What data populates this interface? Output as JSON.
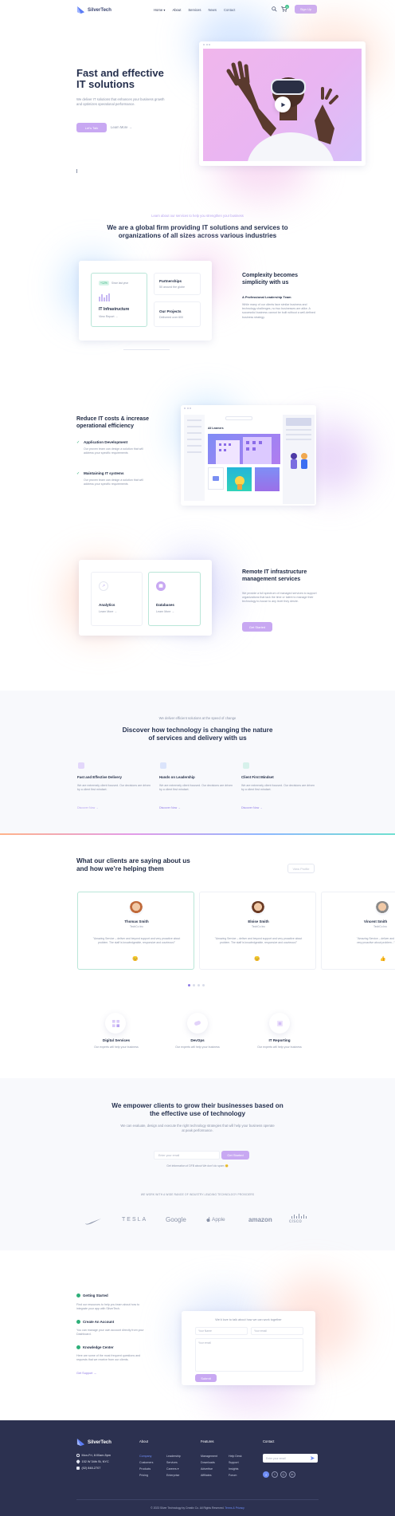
{
  "header": {
    "brand": "SilverTech",
    "nav": [
      "Home ▾",
      "About",
      "Services",
      "News",
      "Contact"
    ],
    "cta": "Sign Up",
    "cart_badge": "0"
  },
  "hero": {
    "title_line1": "Fast and effective",
    "title_line2": "IT solutions",
    "text": "We deliver IT solutions that enhances your business growth and optimizes operational performance.",
    "primary_btn": "Let's Talk",
    "secondary_link": "Learn More →"
  },
  "intro": {
    "eyebrow": "Learn about our services to help you strengthen your business",
    "title_line1": "We are a global firm providing IT solutions and services to",
    "title_line2": "organizations of all sizes across various industries"
  },
  "feature1": {
    "badge": "+12%",
    "badge_note": "Since last year",
    "card1_title": "IT Infrastructure",
    "card1_link": "View Report →",
    "card2_title": "Partnerships",
    "card2_text": "50 around the globe",
    "card3_title": "Our Projects",
    "card3_text": "Delivered over 600",
    "heading_line1": "Complexity becomes",
    "heading_line2": "simplicity with us",
    "subheading": "A Professional Leadership Team",
    "text": "While many of our clients face similar business and technology challenges, no two businesses are alike. A successful business cannot be built without a well-defined business strategy."
  },
  "feature2": {
    "heading_line1": "Reduce IT costs & increase",
    "heading_line2": "operational efficiency",
    "items": [
      {
        "title": "Application Development",
        "text": "Our proven team can design a solution that will address your specific requirements"
      },
      {
        "title": "Maintaining IT systems",
        "text": "Our proven team can design a solution that will address your specific requirements"
      }
    ],
    "app_label": "All Learners",
    "app_tile": "Create Folder"
  },
  "feature3": {
    "card1_title": "Analytics",
    "card1_link": "Learn More →",
    "card2_title": "Databases",
    "card2_link": "Learn More →",
    "heading_line1": "Remote IT infrastructure",
    "heading_line2": "management services",
    "text": "We provide a full spectrum of managed services to support organizations that lack the time or talent to manage their technology in-house to any level they desire.",
    "btn": "Get Started"
  },
  "discover": {
    "eyebrow": "We deliver efficient solutions at the speed of change",
    "title_line1": "Discover how technology is changing the nature",
    "title_line2": "of services and delivery with us",
    "items": [
      {
        "title": "Fast and Effective Delivery",
        "text": "We are extremely client focused. Our decisions are driven by a client first mindset.",
        "link": "Discover Now →"
      },
      {
        "title": "Hands on Leadership",
        "text": "We are extremely client focused. Our decisions are driven by a client first mindset.",
        "link": "Discover Now →"
      },
      {
        "title": "Client First Mindset",
        "text": "We are extremely client focused. Our decisions are driven by a client first mindset.",
        "link": "Discover Now →"
      }
    ]
  },
  "testimonials": {
    "title_line1": "What our clients are saying about us",
    "title_line2": "and how we’re helping them",
    "btn": "View Profile",
    "items": [
      {
        "name": "Thomas Smith",
        "company": "TechCo Inc",
        "quote": "\"Amazing Service – deliver and beyond support and very proactive about problem. The staff is knowledgeable, responsive and courteous!\""
      },
      {
        "name": "Eloise Smith",
        "company": "TechCo Inc",
        "quote": "\"Amazing Service – deliver and beyond support and very proactive about problem. The staff is knowledgeable, responsive and courteous!\""
      },
      {
        "name": "Vincent Smith",
        "company": "TechCo Inc",
        "quote": "\"Amazing Service – deliver and beyond support and very proactive about problem...\""
      }
    ]
  },
  "services": [
    {
      "title": "Digital Services",
      "text": "Our experts will help your business"
    },
    {
      "title": "DevOps",
      "text": "Our experts will help your business"
    },
    {
      "title": "IT Reporting",
      "text": "Our experts will help your business"
    }
  ],
  "cta": {
    "title_line1": "We empower clients to grow their businesses based on",
    "title_line2": "the effective use of technology",
    "text": "We can evaluate, design and execute the right technology strategies that will help your business operate at peak performance.",
    "email_placeholder": "Enter your email",
    "btn": "Get Started",
    "note": "Get information of DFB about We don't do spam",
    "partners_label": "WE WORK WITH A WIDE RANGE OF INDUSTRY-LEADING TECHNOLOGY PROVIDERS",
    "partners": [
      "Nike",
      "TESLA",
      "Google",
      "Apple",
      "amazon",
      "cisco"
    ]
  },
  "contact": {
    "steps": [
      {
        "title": "Getting Started",
        "text": "Find our resources to help you learn about how to integrate your app with SilverTech."
      },
      {
        "title": "Create An Account",
        "text": "You can manage your own account directly from your Dashboard."
      },
      {
        "title": "Knowledge Center",
        "text": "Here are some of the most frequent questions and requests that we receive from our clients."
      }
    ],
    "support_link": "Get Support →",
    "form_title": "We'd love to talk about how we can work together",
    "name_placeholder": "Your Name",
    "email_placeholder": "Your email",
    "message_placeholder": "Your email",
    "submit": "Submit"
  },
  "footer": {
    "brand": "SilverTech",
    "hours": "Mon-Fri, 8:00am-5pm",
    "address": "152 W 34th St, NYC",
    "phone": "(02) 848-2707",
    "col1_title": "About",
    "col1_a": [
      "Company",
      "Customers",
      "Products",
      "Pricing"
    ],
    "col1_b": [
      "Leadership",
      "Services",
      "Careers ▾",
      "Enterprise"
    ],
    "col2_title": "Features",
    "col2_a": [
      "Management",
      "Downloads",
      "Advertise",
      "Affiliates"
    ],
    "col2_b": [
      "Help Desk",
      "Support",
      "Insights",
      "Forum"
    ],
    "col3_title": "Contact",
    "email_placeholder": "Enter your email",
    "copyright": "© 2023 Silver Technology by Creativ Co. All Rights Reserved.",
    "copyright_link": "Terms & Privacy"
  },
  "colors": {
    "accent": "#c8a8f2",
    "link": "#8f7be6",
    "dark": "#2a3050",
    "footer_bg": "#2c3150"
  }
}
